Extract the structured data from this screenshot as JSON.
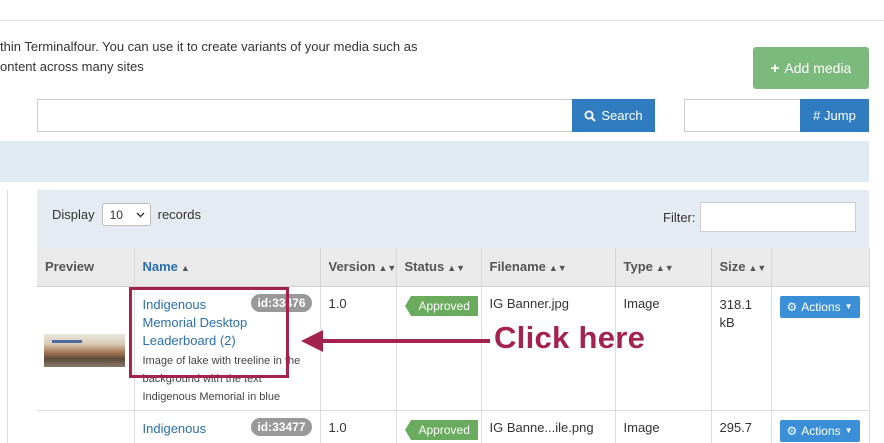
{
  "intro": {
    "line1": "thin Terminalfour. You can use it to create variants of your media such as",
    "line2": "ontent across many sites"
  },
  "toolbar": {
    "add_media_label": "Add media",
    "add_media_icon": "plus-icon",
    "search_label": "Search",
    "search_icon": "search-icon",
    "jump_label": "# Jump",
    "search_value": "",
    "jump_value": ""
  },
  "table_controls": {
    "display_label": "Display",
    "display_value": "10",
    "records_label": "records",
    "filter_label": "Filter:",
    "filter_value": ""
  },
  "columns": [
    "Preview",
    "Name",
    "Version",
    "Status",
    "Filename",
    "Type",
    "Size"
  ],
  "rows": [
    {
      "name": "Indigenous Memorial Desktop Leaderboard (2)",
      "id": "id:33476",
      "description": "Image of lake with treeline in the background with the text Indigenous Memorial in blue",
      "version": "1.0",
      "status": "Approved",
      "filename": "IG Banner.jpg",
      "type": "Image",
      "size": "318.1 kB",
      "actions": "Actions"
    },
    {
      "name": "Indigenous",
      "id": "id:33477",
      "version": "1.0",
      "status": "Approved",
      "filename": "IG Banne...ile.png",
      "type": "Image",
      "size": "295.7",
      "actions": "Actions"
    }
  ],
  "annotation": {
    "text": "Click here",
    "color": "#a3224e"
  },
  "colors": {
    "primary": "#2f7dc0",
    "add_button": "#7cb97c",
    "approved": "#6aab5e",
    "link": "#2a6fb0"
  }
}
